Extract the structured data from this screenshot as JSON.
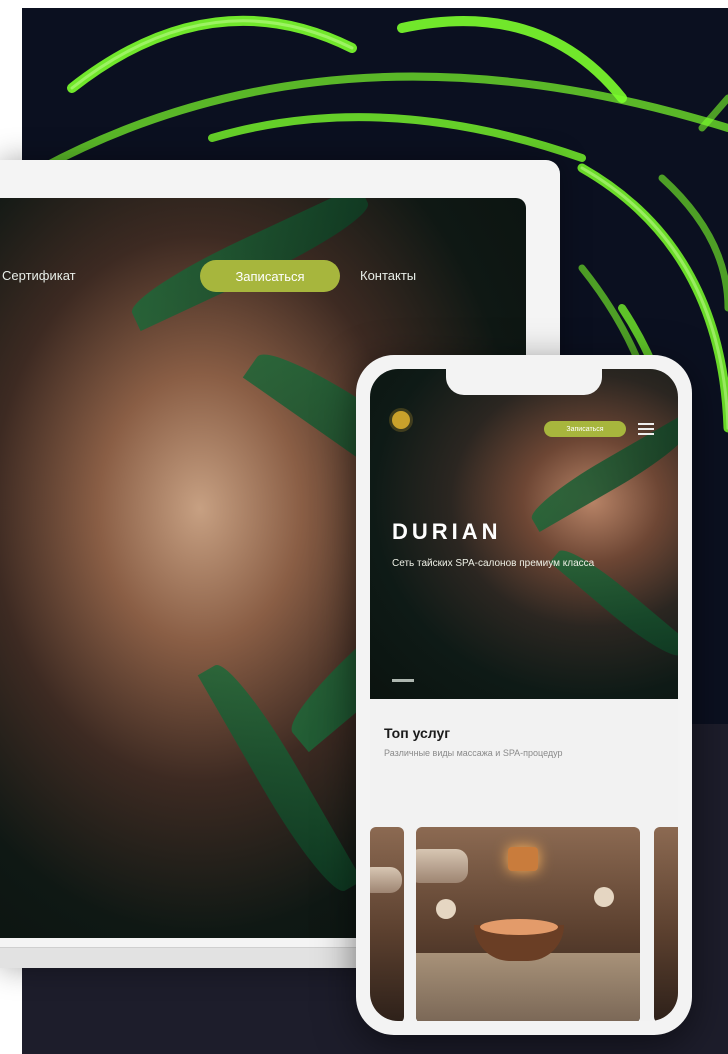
{
  "laptop": {
    "nav": {
      "certificate": "Сертификат",
      "book": "Записаться",
      "contacts": "Контакты"
    }
  },
  "phone": {
    "header": {
      "book": "Записаться"
    },
    "hero": {
      "brand": "DURIAN",
      "tagline": "Сеть тайских SPA-салонов премиум класса"
    },
    "services": {
      "title": "Топ услуг",
      "subtitle": "Различные виды массажа и SPA-процедур"
    }
  },
  "colors": {
    "accent": "#a7b63d",
    "neon": "#7cff2c",
    "background": "#0b1020"
  },
  "icons": [
    "neon-maze-icon",
    "logo-icon",
    "menu-icon"
  ]
}
